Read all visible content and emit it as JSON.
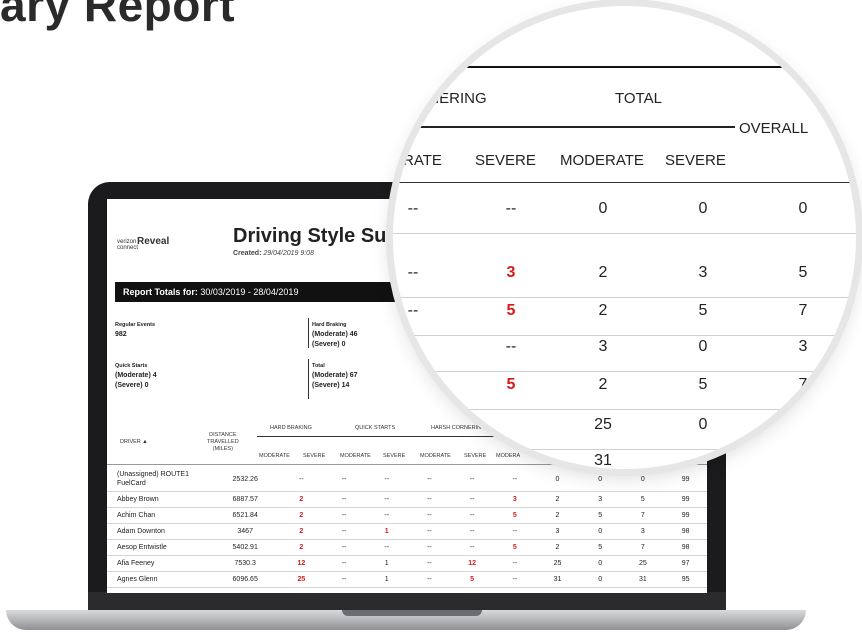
{
  "headline": "ary Report",
  "report": {
    "logo_small": "verizon connect",
    "logo_brand": "Reveal",
    "title": "Driving Style Sur",
    "created_label": "Created:",
    "created_value": "29/04/2019 9:08",
    "totals_label": "Report Totals for:",
    "totals_range": "30/03/2019 - 28/04/2019",
    "summary": {
      "regular_events_label": "Regular Events",
      "regular_events_value": "982",
      "quick_starts_label": "Quick Starts",
      "quick_starts_moderate": "(Moderate) 4",
      "quick_starts_severe": "(Severe) 0",
      "hard_braking_label": "Hard Braking",
      "hard_braking_moderate": "(Moderate) 46",
      "hard_braking_severe": "(Severe) 0",
      "total_label": "Total",
      "total_moderate": "(Moderate) 67",
      "total_severe": "(Severe) 14"
    },
    "headers": {
      "driver": "DRIVER ▲",
      "distance_1": "DISTANCE",
      "distance_2": "TRAVELLED",
      "distance_3": "(MILES)",
      "hard_braking": "HARD BRAKING",
      "quick_starts": "QUICK STARTS",
      "harsh_cornering": "HARSH CORNERIN",
      "moderate": "MODERATE",
      "severe": "SEVERE",
      "moderate_partial": "MODERA"
    },
    "rows": [
      {
        "name": "(Unassigned) ROUTE1 FuelCard",
        "distance": "2532.26",
        "hb_m": "--",
        "hb_s": "--",
        "qs_m": "--",
        "qs_s": "--",
        "hc_m": "--",
        "hc_s": "--",
        "t_m": "0",
        "t_s": "0",
        "overall": "0",
        "score": "99"
      },
      {
        "name": "Abbey Brown",
        "distance": "6887.57",
        "hb_m": "2",
        "hb_s": "--",
        "qs_m": "--",
        "qs_s": "--",
        "hc_m": "--",
        "hc_s": "3",
        "t_m": "2",
        "t_s": "3",
        "overall": "5",
        "score": "99"
      },
      {
        "name": "Achim Chan",
        "distance": "6521.84",
        "hb_m": "2",
        "hb_s": "--",
        "qs_m": "--",
        "qs_s": "--",
        "hc_m": "--",
        "hc_s": "5",
        "t_m": "2",
        "t_s": "5",
        "overall": "7",
        "score": "99"
      },
      {
        "name": "Adam Downton",
        "distance": "3467",
        "hb_m": "2",
        "hb_s": "--",
        "qs_m": "1",
        "qs_s": "--",
        "hc_m": "--",
        "hc_s": "--",
        "t_m": "3",
        "t_s": "0",
        "overall": "3",
        "score": "98"
      },
      {
        "name": "Aesop Entwistle",
        "distance": "5402.91",
        "hb_m": "2",
        "hb_s": "--",
        "qs_m": "--",
        "qs_s": "--",
        "hc_m": "--",
        "hc_s": "5",
        "t_m": "2",
        "t_s": "5",
        "overall": "7",
        "score": "98"
      },
      {
        "name": "Afia Feeney",
        "distance": "7530.3",
        "hb_m": "12",
        "hb_s": "--",
        "qs_m": "1",
        "qs_s": "--",
        "hc_m": "12",
        "hc_s": "--",
        "t_m": "25",
        "t_s": "0",
        "overall": "25",
        "score": "97"
      },
      {
        "name": "Agnes Glenn",
        "distance": "6096.65",
        "hb_m": "25",
        "hb_s": "--",
        "qs_m": "1",
        "qs_s": "--",
        "hc_m": "5",
        "hc_s": "--",
        "t_m": "31",
        "t_s": "0",
        "overall": "31",
        "score": "95"
      }
    ]
  },
  "magnifier": {
    "h_cornering": "CORNERING",
    "h_total": "TOTAL",
    "h_overall": "OVERALL",
    "h_moderate_partial": "ERATE",
    "h_severe": "SEVERE",
    "h_moderate": "MODERATE",
    "h_severe2": "SEVERE",
    "rows": [
      {
        "a": "--",
        "b": "--",
        "c": "0",
        "d": "0",
        "e": "0"
      },
      {
        "a": "--",
        "b": "3",
        "c": "2",
        "d": "3",
        "e": "5"
      },
      {
        "a": "--",
        "b": "5",
        "c": "2",
        "d": "5",
        "e": "7"
      },
      {
        "a": "",
        "b": "--",
        "c": "3",
        "d": "0",
        "e": "3"
      },
      {
        "a": "",
        "b": "5",
        "c": "2",
        "d": "5",
        "e": "7"
      },
      {
        "a": "--",
        "b": "",
        "c": "25",
        "d": "0",
        "e": ""
      },
      {
        "a": "",
        "b": "",
        "c": "31",
        "d": "",
        "e": ""
      }
    ]
  },
  "colors": {
    "accent_red": "#d21b1b",
    "header_bar": "#111111"
  }
}
